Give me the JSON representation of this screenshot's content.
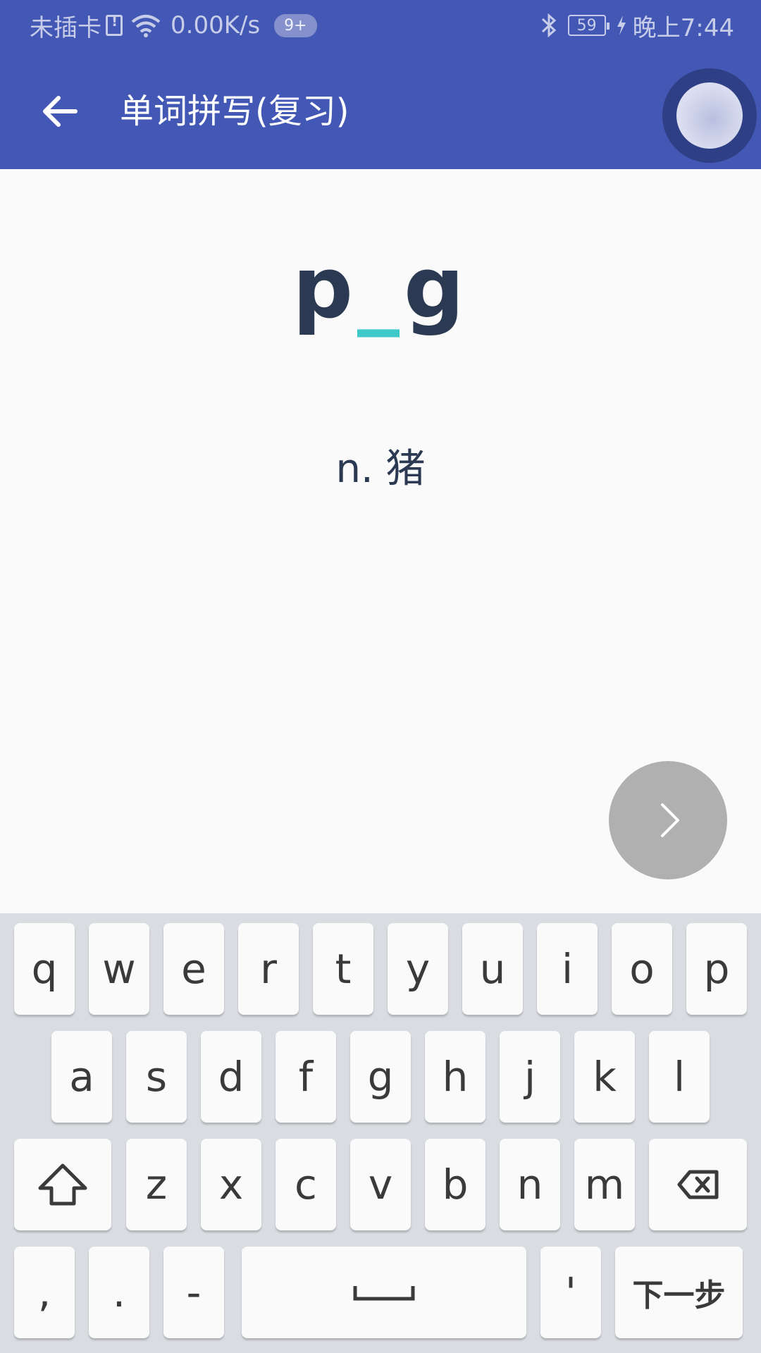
{
  "status_bar": {
    "carrier": "未插卡",
    "speed": "0.00K/s",
    "badge": "9+",
    "battery": "59",
    "time": "晚上7:44"
  },
  "app_bar": {
    "title": "单词拼写(复习)"
  },
  "quiz": {
    "word_prefix": "p",
    "word_blank": "_",
    "word_suffix": "g",
    "meaning": "n. 猪"
  },
  "icons": {
    "back": "arrow-left-icon",
    "next": "chevron-right-icon",
    "shift": "shift-arrow-icon",
    "backspace": "backspace-icon",
    "space": "space-bar-icon"
  },
  "colors": {
    "primary": "#4358b5",
    "accent_blank": "#3ec8c8",
    "text_dark": "#2b3a52",
    "fab_disabled": "#b0b0b0",
    "keyboard_bg": "#d9dce1"
  },
  "keyboard": {
    "row1": [
      "q",
      "w",
      "e",
      "r",
      "t",
      "y",
      "u",
      "i",
      "o",
      "p"
    ],
    "row2": [
      "a",
      "s",
      "d",
      "f",
      "g",
      "h",
      "j",
      "k",
      "l"
    ],
    "row3": [
      "z",
      "x",
      "c",
      "v",
      "b",
      "n",
      "m"
    ],
    "comma": ",",
    "period": ".",
    "dash": "-",
    "apostrophe": "'",
    "next_step": "下一步"
  }
}
